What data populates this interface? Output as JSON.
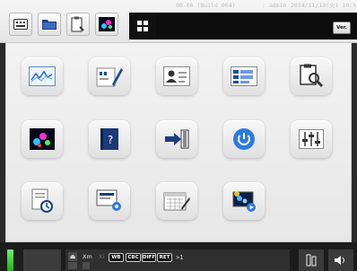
{
  "header": {
    "build_text": "00-06 (Build 004)",
    "user_text": ": admin",
    "datetime_text": "2014/11/18(火) 10:53",
    "version_button": "Ver.",
    "toolbar_icons": [
      "keyboard-icon",
      "folder-icon",
      "clipboard-icon",
      "spectrum-icon"
    ],
    "home_icon": "apps-grid-icon"
  },
  "menu": {
    "tiles": [
      {
        "icon": "waveform-chart-icon"
      },
      {
        "icon": "test-edit-icon"
      },
      {
        "icon": "patient-card-icon"
      },
      {
        "icon": "list-editor-icon"
      },
      {
        "icon": "report-search-icon"
      },
      {
        "icon": "spectrum-display-icon"
      },
      {
        "icon": "help-manual-icon"
      },
      {
        "icon": "logout-icon"
      },
      {
        "icon": "power-icon"
      },
      {
        "icon": "equalizer-settings-icon"
      },
      {
        "icon": "document-timer-icon"
      },
      {
        "icon": "monitor-settings-icon"
      },
      {
        "icon": "calendar-schedule-icon"
      },
      {
        "icon": "video-playback-icon"
      }
    ]
  },
  "footer": {
    "abbr_xm": "Xm",
    "abbr_dim": "Xi",
    "mode_buttons": [
      "WB",
      "CBC",
      "DIFF",
      "RET"
    ],
    "prompt": ">1",
    "colors": {
      "lamp": "#2fd32f",
      "background": "#1c1c1c"
    }
  }
}
